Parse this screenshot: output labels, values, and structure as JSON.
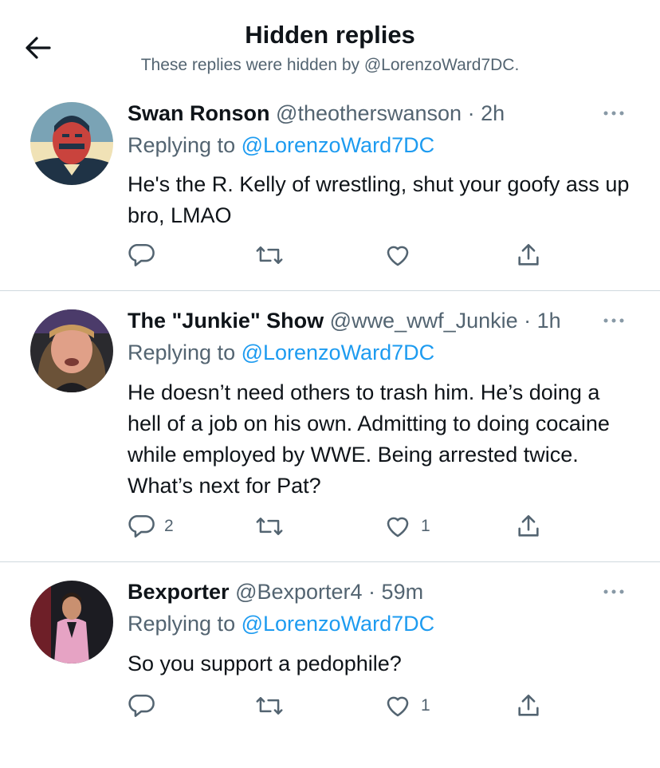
{
  "header": {
    "title": "Hidden replies",
    "subtitle": "These replies were hidden by @LorenzoWard7DC."
  },
  "replies": [
    {
      "name": "Swan Ronson",
      "handle": "@theotherswanson",
      "time": "2h",
      "replying_prefix": "Replying to ",
      "replying_to": "@LorenzoWard7DC",
      "text": "He's the R. Kelly of wrestling, shut your goofy ass up bro, LMAO",
      "reply_count": "",
      "retweet_count": "",
      "like_count": ""
    },
    {
      "name": "The \"Junkie\" Show",
      "handle": "@wwe_wwf_Junkie",
      "time": "1h",
      "replying_prefix": "Replying to ",
      "replying_to": "@LorenzoWard7DC",
      "text": "He doesn’t need others to trash him. He’s doing a hell of a job on his own. Admitting to doing cocaine while employed by WWE. Being arrested twice. What’s next for Pat?",
      "reply_count": "2",
      "retweet_count": "",
      "like_count": "1"
    },
    {
      "name": "Bexporter",
      "handle": "@Bexporter4",
      "time": "59m",
      "replying_prefix": "Replying to ",
      "replying_to": "@LorenzoWard7DC",
      "text": "So you support a pedophile?",
      "reply_count": "",
      "retweet_count": "",
      "like_count": "1"
    }
  ],
  "colors": {
    "text_primary": "#0f1419",
    "text_secondary": "#536471",
    "link": "#1d9bf0",
    "divider": "#cfd9de"
  },
  "icons": {
    "back": "arrow-left-icon",
    "more": "more-dots-icon",
    "reply": "reply-bubble-icon",
    "retweet": "retweet-icon",
    "like": "heart-icon",
    "share": "share-icon"
  }
}
